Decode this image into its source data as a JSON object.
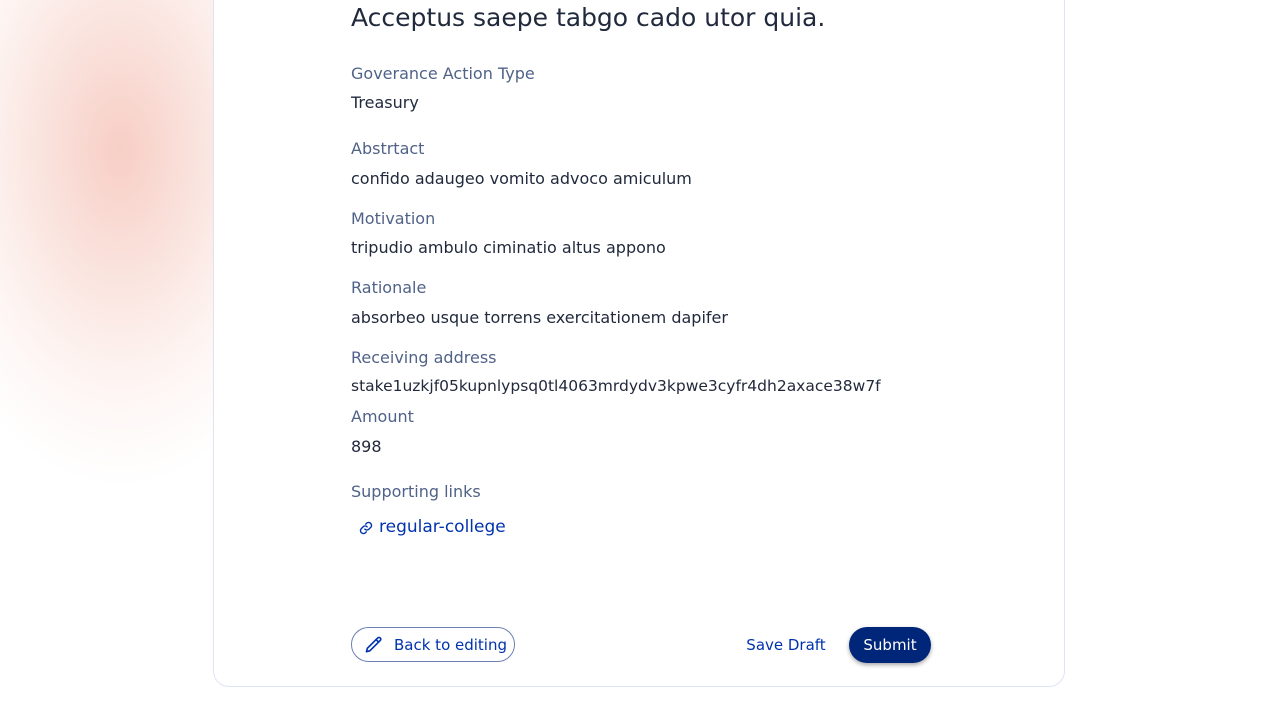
{
  "proposal": {
    "title": "Acceptus saepe tabgo cado utor quia.",
    "fields": [
      {
        "label": "Goverance Action Type",
        "value": "Treasury"
      },
      {
        "label": "Abstrtact",
        "value": "confido adaugeo vomito advoco amiculum"
      },
      {
        "label": "Motivation",
        "value": "tripudio ambulo ciminatio altus appono"
      },
      {
        "label": "Rationale",
        "value": "absorbeo usque torrens exercitationem dapifer"
      },
      {
        "label": "Receiving address",
        "value": "stake1uzkjf05kupnlypsq0tl4063mrdydv3kpwe3cyfr4dh2axace38w7f"
      },
      {
        "label": "Amount",
        "value": "898"
      }
    ],
    "supporting_links_label": "Supporting links",
    "links": [
      {
        "text": "regular-college",
        "icon": "link-icon"
      }
    ]
  },
  "actions": {
    "back_label": "Back to editing",
    "back_icon": "pencil-icon",
    "draft_label": "Save Draft",
    "submit_label": "Submit"
  },
  "colors": {
    "accent": "#0033ad",
    "submit_bg": "#002679",
    "label": "#506288",
    "text": "#212a3d"
  }
}
